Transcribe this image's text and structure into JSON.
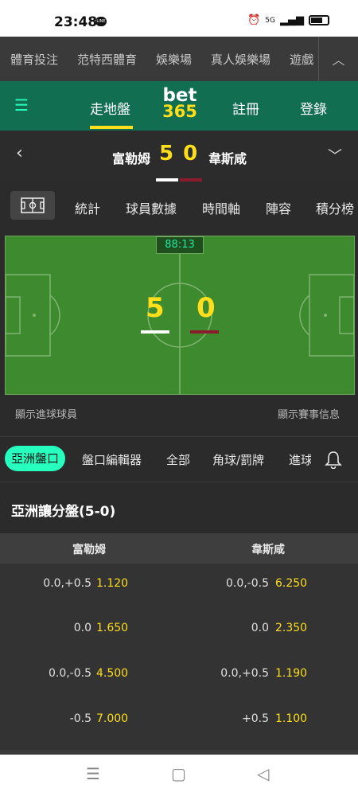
{
  "statusbar": {
    "time": "23:48",
    "line_badge": "LINE",
    "network": "5G",
    "icons": [
      "alarm-icon",
      "signal-icon",
      "battery-icon"
    ]
  },
  "sport_nav": {
    "items": [
      "體育投注",
      "范特西體育",
      "娛樂場",
      "真人娛樂場",
      "遊戲"
    ],
    "collapse_icon": "chevron-up-icon"
  },
  "header": {
    "menu_icon": "hamburger-icon",
    "live_label": "走地盤",
    "logo_top": "bet",
    "logo_bottom": "365",
    "register_label": "註冊",
    "login_label": "登錄"
  },
  "match": {
    "home_team": "富勒姆",
    "away_team": "韋斯咸",
    "home_score": "5",
    "away_score": "0",
    "back_icon": "chevron-left-icon",
    "expand_icon": "chevron-down-icon"
  },
  "match_tabs": {
    "items": [
      "統計",
      "球員數據",
      "時間軸",
      "陣容",
      "積分榜"
    ],
    "pitch_icon": "pitch-icon"
  },
  "field": {
    "clock": "88:13",
    "home_score": "5",
    "away_score": "0"
  },
  "field_links": {
    "left": "顯示進球球員",
    "right": "顯示賽事信息"
  },
  "market_tabs": {
    "active": "亞洲盤口",
    "items": [
      "盤口編輯器",
      "全部",
      "角球/罰牌",
      "進球"
    ],
    "bell_icon": "bell-icon"
  },
  "market": {
    "title": "亞洲讓分盤(5-0)",
    "home_header": "富勒姆",
    "away_header": "韋斯咸",
    "rows": [
      {
        "home_handicap": "0.0,+0.5",
        "home_odds": "1.120",
        "away_handicap": "0.0,-0.5",
        "away_odds": "6.250"
      },
      {
        "home_handicap": "0.0",
        "home_odds": "1.650",
        "away_handicap": "0.0",
        "away_odds": "2.350"
      },
      {
        "home_handicap": "0.0,-0.5",
        "home_odds": "4.500",
        "away_handicap": "0.0,+0.5",
        "away_odds": "1.190"
      },
      {
        "home_handicap": "-0.5",
        "home_odds": "7.000",
        "away_handicap": "+0.5",
        "away_odds": "1.100"
      }
    ]
  },
  "android_nav": {
    "icons": [
      "recents-icon",
      "home-icon",
      "back-icon"
    ]
  },
  "colors": {
    "brand_green": "#126e51",
    "accent_yellow": "#ffdf1b",
    "accent_mint": "#26ffbe",
    "away_kit": "#8a1c2e"
  }
}
